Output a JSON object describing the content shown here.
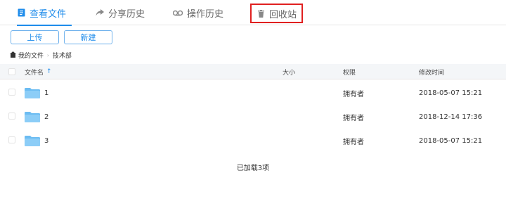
{
  "tabs": [
    {
      "label": "查看文件",
      "icon": "file-view-icon",
      "active": true
    },
    {
      "label": "分享历史",
      "icon": "share-icon"
    },
    {
      "label": "操作历史",
      "icon": "history-icon"
    },
    {
      "label": "回收站",
      "icon": "trash-icon"
    }
  ],
  "toolbar": {
    "upload_label": "上传",
    "new_label": "新建"
  },
  "breadcrumb": {
    "root": "我的文件",
    "current": "技术部"
  },
  "table": {
    "headers": {
      "name": "文件名",
      "size": "大小",
      "permission": "权限",
      "modified": "修改时间"
    },
    "rows": [
      {
        "name": "1",
        "size": "",
        "permission": "拥有者",
        "modified": "2018-05-07 15:21"
      },
      {
        "name": "2",
        "size": "",
        "permission": "拥有者",
        "modified": "2018-12-14 17:36"
      },
      {
        "name": "3",
        "size": "",
        "permission": "拥有者",
        "modified": "2018-05-07 15:21"
      }
    ]
  },
  "status": {
    "loaded_text": "已加载3项"
  },
  "colors": {
    "accent": "#1f8ceb",
    "folder": "#6cbcf2",
    "highlight_border": "#e02020"
  }
}
